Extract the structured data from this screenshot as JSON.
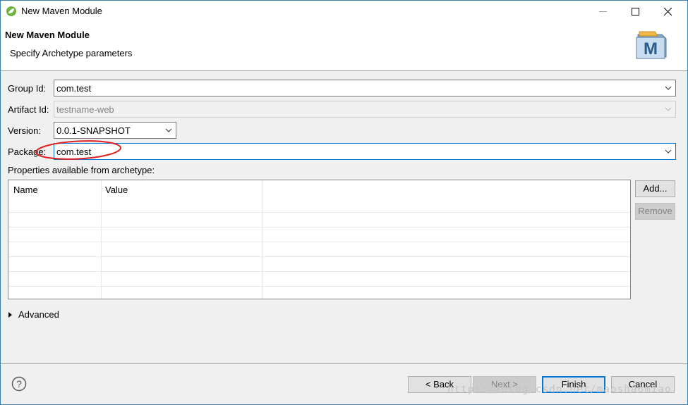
{
  "window": {
    "title": "New Maven Module",
    "icon": "spring-leaf-icon",
    "controls": {
      "minimize": "—",
      "maximize": "☐",
      "close": "✕"
    }
  },
  "banner": {
    "title": "New Maven Module",
    "subtitle": "Specify Archetype parameters",
    "icon": "maven-m-icon"
  },
  "form": {
    "group_id": {
      "label": "Group Id:",
      "value": "com.test"
    },
    "artifact_id": {
      "label": "Artifact Id:",
      "value": "testname-web",
      "enabled": false
    },
    "version": {
      "label": "Version:",
      "value": "0.0.1-SNAPSHOT"
    },
    "package": {
      "label": "Package:",
      "value": "com.test"
    }
  },
  "properties": {
    "label": "Properties available from archetype:",
    "columns": [
      "Name",
      "Value"
    ],
    "rows": [],
    "add_label": "Add...",
    "remove_label": "Remove"
  },
  "advanced": {
    "label": "Advanced"
  },
  "footer": {
    "help_icon": "help-icon",
    "back_label": "< Back",
    "next_label": "Next >",
    "finish_label": "Finish",
    "cancel_label": "Cancel"
  },
  "watermark": "https://blog.csdn.net/maoshaomiao",
  "colors": {
    "focus_border": "#0078d7",
    "annotation_red": "#e02020",
    "window_border": "#3c7fb1"
  }
}
